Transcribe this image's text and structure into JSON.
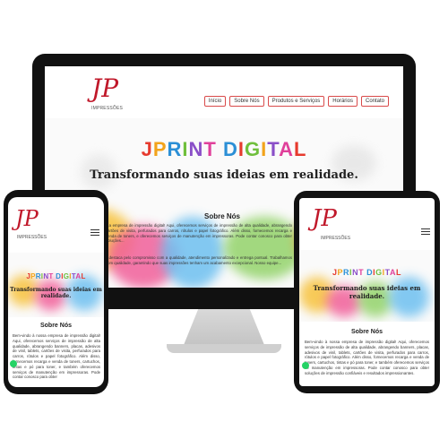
{
  "logo": {
    "letters": "JP",
    "subtitle": "IMPRESSÕES"
  },
  "nav": [
    {
      "label": "Início"
    },
    {
      "label": "Sobre Nós"
    },
    {
      "label": "Produtos e Serviços"
    },
    {
      "label": "Horários"
    },
    {
      "label": "Contato"
    }
  ],
  "hero": {
    "title_letters": [
      "J",
      "P",
      "R",
      "I",
      "N",
      "T",
      " ",
      "D",
      "I",
      "G",
      "I",
      "T",
      "A",
      "L"
    ],
    "subtitle": "Transformando suas ideias em realidade."
  },
  "about": {
    "heading": "Sobre Nós",
    "desktop_text_1": "...a empresa de impressão digital! Aqui, oferecemos serviços de impressão de alta qualidade, abrangendo cartões de visita, perfurados para carros, rótulos e papel fotográfico. Além disso, fornecemos recarga e venda de toners, e oferecemos serviços de manutenção em impressoras. Pode contar conosco para obter soluções...",
    "desktop_text_2": "...destaca pelo compromisso com a qualidade, atendimento personalizado e entrega pontual. Trabalhamos com qualidade, garantindo que suas impressões tenham um acabamento excepcional. Nosso equipe...",
    "mobile_text": "Bem-vindo à nossa empresa de impressão digital! Aqui, oferecemos serviços de impressão de alta qualidade, abrangendo banners, placas, adesivos de vinil, tablets, cartões de visita, perfurados para carros, rótulos e papel fotográfico. Além disso, fornecemos recarga e venda de toners, cartuchos, tintas e pó para toner, e também oferecemos serviços de manutenção em impressoras. Pode contar conosco para obter",
    "tablet_text": "Bem-vindo à nossa empresa de impressão digital! Aqui, oferecemos serviços de impressão de alta qualidade, abrangendo banners, placas, adesivos de vinil, tablets, cartões de visita, perfurados para carros, rótulos e papel fotográfico. Além disso, fornecemos recarga e venda de toners, cartuchos, tintas e pó para toner, e também oferecemos serviços de manutenção em impressoras. Pode contar conosco para obter soluções de impressão confiáveis e resultados impressionantes."
  },
  "colors": {
    "brand_red": "#c0182a",
    "title_palette": [
      "#e63a2e",
      "#f2a31b",
      "#2b8fd6",
      "#6fbf3c",
      "#8a4fc8",
      "#e0409a"
    ]
  }
}
